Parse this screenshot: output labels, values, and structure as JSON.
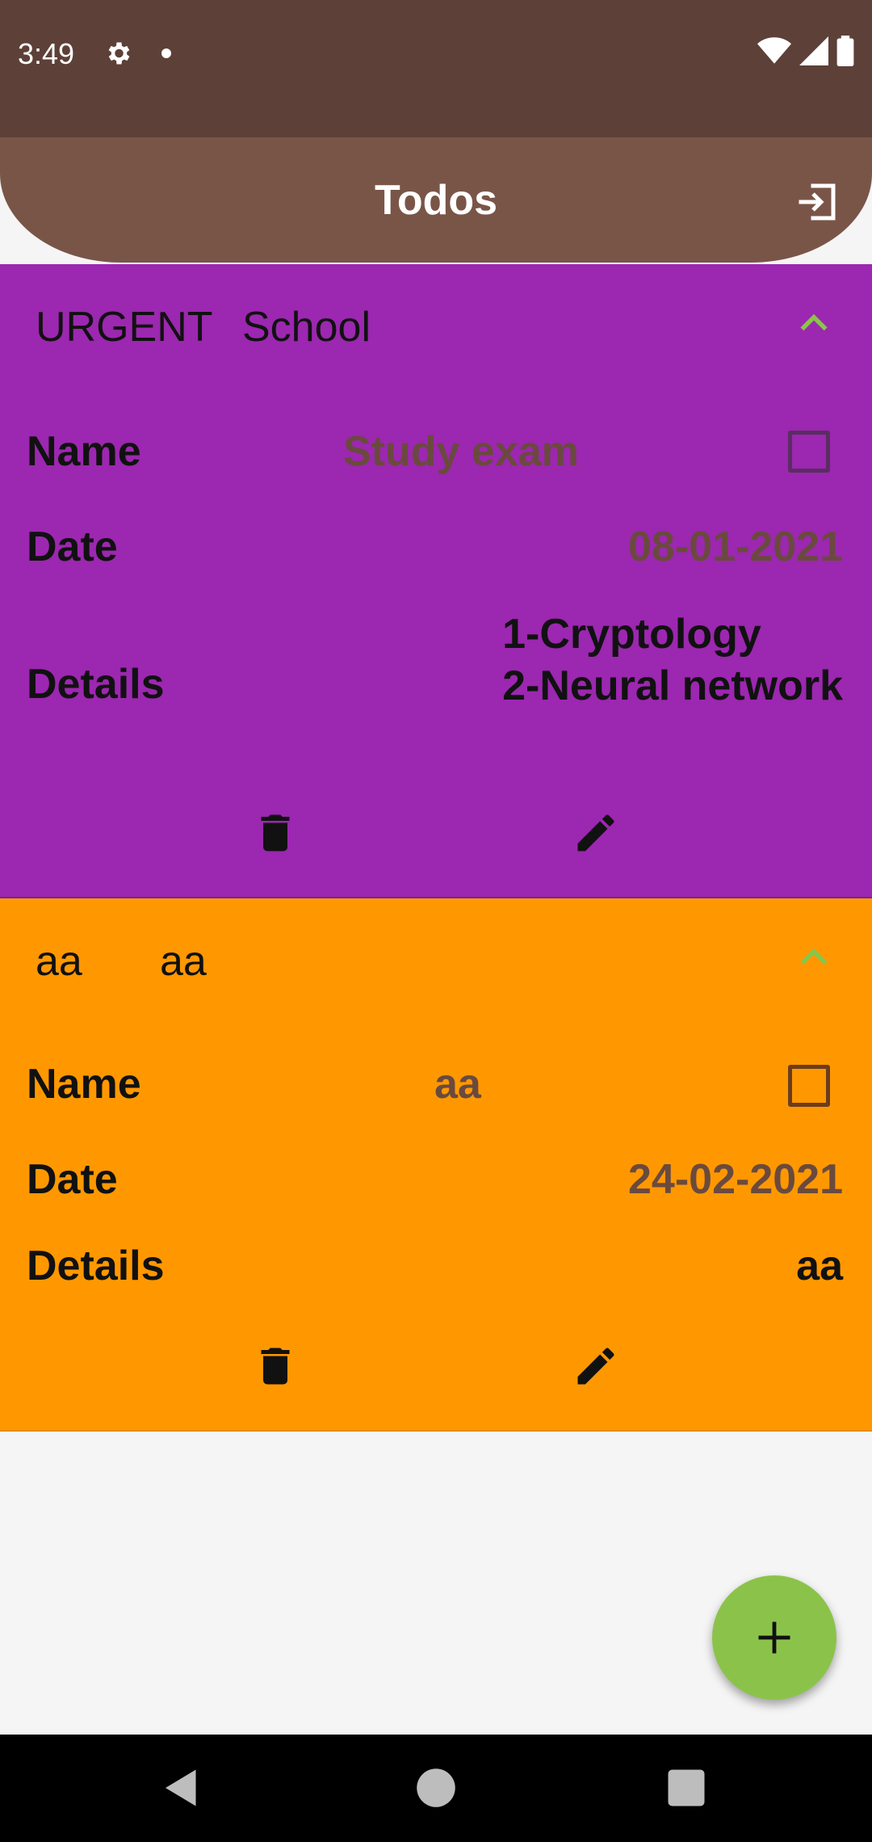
{
  "status_bar": {
    "time": "3:49"
  },
  "app_bar": {
    "title": "Todos",
    "logout_icon": "logout-icon"
  },
  "todos": [
    {
      "priority": "URGENT",
      "category": "School",
      "color": "#9c27b0",
      "name_label": "Name",
      "name_value": "Study exam",
      "date_label": "Date",
      "date_value": "08-01-2021",
      "details_label": "Details",
      "details_lines": [
        "1-Cryptology",
        "2-Neural network"
      ],
      "completed": false,
      "delete_icon": "delete-icon",
      "edit_icon": "edit-icon"
    },
    {
      "priority": "aa",
      "category": "aa",
      "color": "#ff9800",
      "name_label": "Name",
      "name_value": "aa",
      "date_label": "Date",
      "date_value": "24-02-2021",
      "details_label": "Details",
      "details_value": "aa",
      "completed": false,
      "delete_icon": "delete-icon",
      "edit_icon": "edit-icon"
    }
  ],
  "fab": {
    "icon": "add-icon",
    "color": "#8bc34a"
  },
  "colors": {
    "status_bar": "#5d4037",
    "app_bar": "#795548",
    "accent": "#8bc34a"
  }
}
